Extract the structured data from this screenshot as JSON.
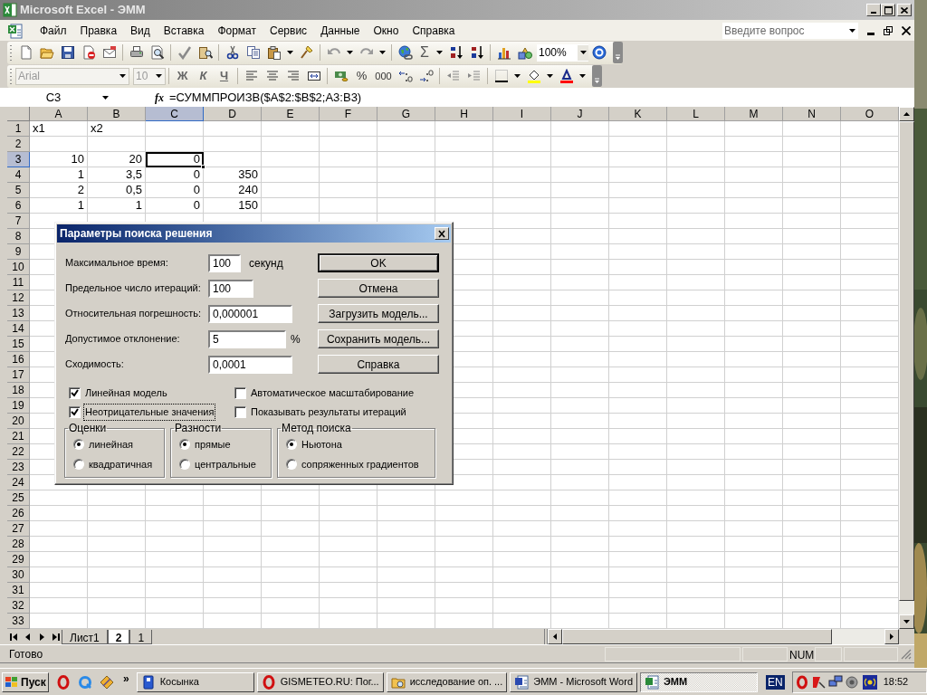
{
  "window": {
    "title": "Microsoft Excel - ЭММ"
  },
  "menu": [
    "Файл",
    "Правка",
    "Вид",
    "Вставка",
    "Формат",
    "Сервис",
    "Данные",
    "Окно",
    "Справка"
  ],
  "help_box": {
    "placeholder": "Введите вопрос"
  },
  "standard_toolbar": {
    "sum": "Σ",
    "zoom": "100%"
  },
  "formatting_toolbar": {
    "font": "Arial",
    "font_size": "10",
    "bold": "Ж",
    "italic": "К",
    "underline": "Ч",
    "percent": "%",
    "thousands": "000"
  },
  "formula_bar": {
    "name_box": "C3",
    "function_label": "fx",
    "formula": "=СУММПРОИЗВ($A$2:$B$2;A3:B3)"
  },
  "sheet": {
    "columns": [
      {
        "label": "A",
        "selected": false
      },
      {
        "label": "B",
        "selected": false
      },
      {
        "label": "C",
        "selected": true
      },
      {
        "label": "D",
        "selected": false
      },
      {
        "label": "E",
        "selected": false
      },
      {
        "label": "F",
        "selected": false
      },
      {
        "label": "G",
        "selected": false
      },
      {
        "label": "H",
        "selected": false
      },
      {
        "label": "I",
        "selected": false
      },
      {
        "label": "J",
        "selected": false
      },
      {
        "label": "K",
        "selected": false
      },
      {
        "label": "L",
        "selected": false
      },
      {
        "label": "M",
        "selected": false
      },
      {
        "label": "N",
        "selected": false
      },
      {
        "label": "O",
        "selected": false
      }
    ],
    "rows": [
      {
        "label": "1",
        "selected": false,
        "cells": {
          "A": {
            "value": "x1",
            "kind": "text",
            "selected": false
          },
          "B": {
            "value": "x2",
            "kind": "text",
            "selected": false
          }
        }
      },
      {
        "label": "2",
        "selected": false
      },
      {
        "label": "3",
        "selected": true,
        "cells": {
          "A": {
            "value": "10",
            "kind": "number",
            "selected": false
          },
          "B": {
            "value": "20",
            "kind": "number",
            "selected": false
          },
          "C": {
            "value": "0",
            "kind": "number",
            "selected": true
          }
        }
      },
      {
        "label": "4",
        "selected": false,
        "cells": {
          "A": {
            "value": "1",
            "kind": "number",
            "selected": false
          },
          "B": {
            "value": "3,5",
            "kind": "number",
            "selected": false
          },
          "C": {
            "value": "0",
            "kind": "number",
            "selected": false
          },
          "D": {
            "value": "350",
            "kind": "number",
            "selected": false
          }
        }
      },
      {
        "label": "5",
        "selected": false,
        "cells": {
          "A": {
            "value": "2",
            "kind": "number",
            "selected": false
          },
          "B": {
            "value": "0,5",
            "kind": "number",
            "selected": false
          },
          "C": {
            "value": "0",
            "kind": "number",
            "selected": false
          },
          "D": {
            "value": "240",
            "kind": "number",
            "selected": false
          }
        }
      },
      {
        "label": "6",
        "selected": false,
        "cells": {
          "A": {
            "value": "1",
            "kind": "number",
            "selected": false
          },
          "B": {
            "value": "1",
            "kind": "number",
            "selected": false
          },
          "C": {
            "value": "0",
            "kind": "number",
            "selected": false
          },
          "D": {
            "value": "150",
            "kind": "number",
            "selected": false
          }
        }
      },
      {
        "label": "7",
        "selected": false
      },
      {
        "label": "8",
        "selected": false
      },
      {
        "label": "9",
        "selected": false
      },
      {
        "label": "10",
        "selected": false
      },
      {
        "label": "11",
        "selected": false
      },
      {
        "label": "12",
        "selected": false
      },
      {
        "label": "13",
        "selected": false
      },
      {
        "label": "14",
        "selected": false
      },
      {
        "label": "15",
        "selected": false
      },
      {
        "label": "16",
        "selected": false
      },
      {
        "label": "17",
        "selected": false
      },
      {
        "label": "18",
        "selected": false
      },
      {
        "label": "19",
        "selected": false
      },
      {
        "label": "20",
        "selected": false
      },
      {
        "label": "21",
        "selected": false
      },
      {
        "label": "22",
        "selected": false
      },
      {
        "label": "23",
        "selected": false
      },
      {
        "label": "24",
        "selected": false
      },
      {
        "label": "25",
        "selected": false
      },
      {
        "label": "26",
        "selected": false
      },
      {
        "label": "27",
        "selected": false
      },
      {
        "label": "28",
        "selected": false
      },
      {
        "label": "29",
        "selected": false
      },
      {
        "label": "30",
        "selected": false
      },
      {
        "label": "31",
        "selected": false
      },
      {
        "label": "32",
        "selected": false
      },
      {
        "label": "33",
        "selected": false
      }
    ]
  },
  "sheet_tabs": [
    {
      "label": "Лист1",
      "selected": false
    },
    {
      "label": "2",
      "selected": true
    },
    {
      "label": "1",
      "selected": false
    }
  ],
  "status_bar": {
    "status": "Готово",
    "indicator": "NUM"
  },
  "dialog": {
    "title": "Параметры поиска решения",
    "fields": [
      {
        "label": "Максимальное время:",
        "value": "100",
        "unit": "секунд"
      },
      {
        "label": "Предельное число итераций:",
        "value": "100"
      },
      {
        "label": "Относительная погрешность:",
        "value": "0,000001"
      },
      {
        "label": "Допустимое отклонение:",
        "value": "5",
        "unit": "%"
      },
      {
        "label": "Сходимость:",
        "value": "0,0001"
      }
    ],
    "buttons": [
      {
        "label": "OK",
        "default": true
      },
      {
        "label": "Отмена",
        "default": false
      },
      {
        "label": "Загрузить модель...",
        "default": false
      },
      {
        "label": "Сохранить модель...",
        "default": false
      },
      {
        "label": "Справка",
        "default": false
      }
    ],
    "checkboxes": [
      {
        "label": "Линейная модель",
        "checked": true,
        "focused": false
      },
      {
        "label": "Автоматическое масштабирование",
        "checked": false,
        "focused": false
      },
      {
        "label": "Неотрицательные значения",
        "checked": true,
        "focused": true
      },
      {
        "label": "Показывать результаты итераций",
        "checked": false,
        "focused": false
      }
    ],
    "groups": [
      {
        "title": "Оценки",
        "options": [
          {
            "label": "линейная",
            "selected": true
          },
          {
            "label": "квадратичная",
            "selected": false
          }
        ]
      },
      {
        "title": "Разности",
        "options": [
          {
            "label": "прямые",
            "selected": true
          },
          {
            "label": "центральные",
            "selected": false
          }
        ]
      },
      {
        "title": "Метод поиска",
        "options": [
          {
            "label": "Ньютона",
            "selected": true
          },
          {
            "label": "сопряженных градиентов",
            "selected": false
          }
        ]
      }
    ]
  },
  "taskbar": {
    "start": "Пуск",
    "more": "»",
    "tasks": [
      {
        "label": "Косынка",
        "selected": false
      },
      {
        "label": "GISMETEO.RU: Пог...",
        "selected": false
      },
      {
        "label": "исследование оп. ...",
        "selected": false
      },
      {
        "label": "ЭММ - Microsoft Word",
        "selected": false
      },
      {
        "label": "ЭММ",
        "selected": true
      }
    ],
    "language": "EN",
    "clock": "18:52"
  }
}
